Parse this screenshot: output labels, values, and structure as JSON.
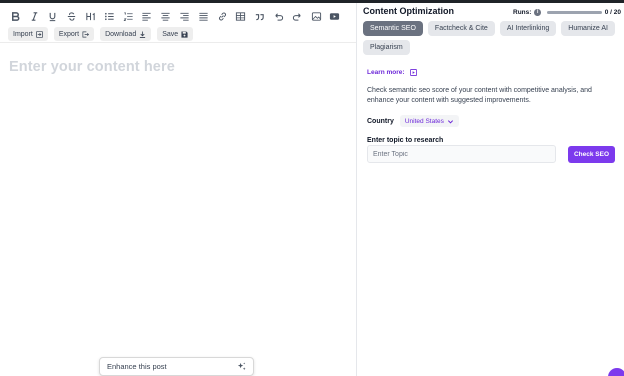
{
  "editor": {
    "toolbar": {
      "format_icons": [
        "bold-icon",
        "italic-icon",
        "underline-icon",
        "strikethrough-icon",
        "heading-icon",
        "bullet-list-icon",
        "numbered-list-icon",
        "align-left-icon",
        "align-center-icon",
        "align-right-icon",
        "align-justify-icon",
        "link-icon",
        "table-icon",
        "quote-icon",
        "undo-icon",
        "redo-icon",
        "image-icon",
        "video-icon"
      ],
      "actions": [
        {
          "label": "Import",
          "icon": "import-icon"
        },
        {
          "label": "Export",
          "icon": "export-icon"
        },
        {
          "label": "Download",
          "icon": "download-icon"
        },
        {
          "label": "Save",
          "icon": "save-icon"
        }
      ]
    },
    "placeholder": "Enter your content here",
    "enhance_label": "Enhance this post",
    "enhance_icon": "sparkle-icon"
  },
  "panel": {
    "title": "Content Optimization",
    "runs": {
      "label": "Runs:",
      "count": "0 / 20",
      "used_fraction": 0.0
    },
    "tabs": [
      {
        "label": "Semantic SEO",
        "active": true
      },
      {
        "label": "Factcheck & Cite",
        "active": false
      },
      {
        "label": "AI Interlinking",
        "active": false
      },
      {
        "label": "Humanize AI",
        "active": false
      },
      {
        "label": "Plagiarism",
        "active": false
      }
    ],
    "learn_more": "Learn more:",
    "description": "Check semantic seo score of your content with competitive analysis, and enhance your content with suggested improvements.",
    "country": {
      "label": "Country",
      "value": "United States"
    },
    "topic": {
      "label": "Enter topic to research",
      "placeholder": "Enter Topic",
      "value": ""
    },
    "check_label": "Check SEO"
  },
  "colors": {
    "accent": "#7c3aed",
    "active_tab": "#6b7280",
    "tab_bg": "#e5e7eb"
  }
}
